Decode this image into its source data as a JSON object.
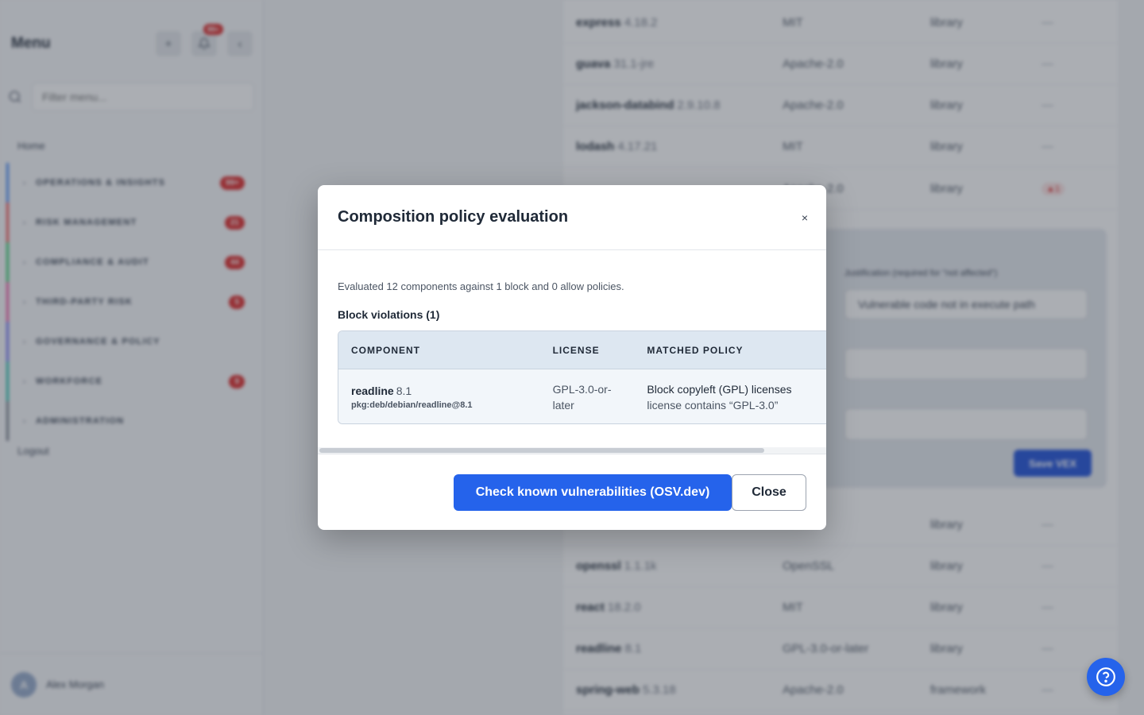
{
  "sidebar": {
    "title": "Menu",
    "notification_count": "99+",
    "filter_placeholder": "Filter menu...",
    "home_label": "Home",
    "sections": [
      {
        "label": "OPERATIONS & INSIGHTS",
        "badge": "99+",
        "color": "#3b82f6"
      },
      {
        "label": "RISK MANAGEMENT",
        "badge": "21",
        "color": "#ef4444"
      },
      {
        "label": "COMPLIANCE & AUDIT",
        "badge": "44",
        "color": "#22c55e"
      },
      {
        "label": "THIRD-PARTY RISK",
        "badge": "5",
        "color": "#ec4899"
      },
      {
        "label": "GOVERNANCE & POLICY",
        "badge": "",
        "color": "#6366f1"
      },
      {
        "label": "WORKFORCE",
        "badge": "9",
        "color": "#14b8a6"
      },
      {
        "label": "ADMINISTRATION",
        "badge": "",
        "color": "#6b7280"
      }
    ],
    "logout_label": "Logout",
    "user": {
      "initial": "A",
      "name": "Alex Morgan"
    }
  },
  "background_table": {
    "rows_top": [
      {
        "name": "express",
        "version": "4.18.2",
        "license": "MIT",
        "type": "library",
        "extra": "—"
      },
      {
        "name": "guava",
        "version": "31.1-jre",
        "license": "Apache-2.0",
        "type": "library",
        "extra": "—"
      },
      {
        "name": "jackson-databind",
        "version": "2.9.10.8",
        "license": "Apache-2.0",
        "type": "library",
        "extra": "—"
      },
      {
        "name": "lodash",
        "version": "4.17.21",
        "license": "MIT",
        "type": "library",
        "extra": "—"
      }
    ],
    "partial_row": {
      "license": "Apache-2.0",
      "type": "library",
      "critical": "▲1"
    },
    "rows_bottom": [
      {
        "name": "",
        "version": "",
        "license": "",
        "type": "library",
        "extra": "—"
      },
      {
        "name": "openssl",
        "version": "1.1.1k",
        "license": "OpenSSL",
        "type": "library",
        "extra": "—"
      },
      {
        "name": "react",
        "version": "18.2.0",
        "license": "MIT",
        "type": "library",
        "extra": "—"
      },
      {
        "name": "readline",
        "version": "8.1",
        "license": "GPL-3.0-or-later",
        "type": "library",
        "extra": "—"
      },
      {
        "name": "spring-web",
        "version": "5.3.18",
        "license": "Apache-2.0",
        "type": "framework",
        "extra": "—"
      }
    ],
    "vex": {
      "justification_label": "Justification (required for \"not affected\")",
      "justification_value": "Vulnerable code not in execute path",
      "save_label": "Save VEX"
    }
  },
  "modal": {
    "title": "Composition policy evaluation",
    "close_icon": "×",
    "summary": "Evaluated 12 components against 1 block and 0 allow policies.",
    "violations_title": "Block violations (1)",
    "columns": [
      "COMPONENT",
      "LICENSE",
      "MATCHED POLICY"
    ],
    "violation": {
      "component_name": "readline",
      "component_version": "8.1",
      "purl": "pkg:deb/debian/readline@8.1",
      "license": "GPL-3.0-or-later",
      "policy_name": "Block copyleft (GPL) licenses",
      "policy_reason": "license contains “GPL-3.0”"
    },
    "primary_button": "Check known vulnerabilities (OSV.dev)",
    "secondary_button": "Close"
  },
  "colors": {
    "primary": "#2563eb",
    "danger": "#dc2626",
    "table_header_bg": "#dde7f1"
  },
  "help_icon": "question-circle-icon"
}
